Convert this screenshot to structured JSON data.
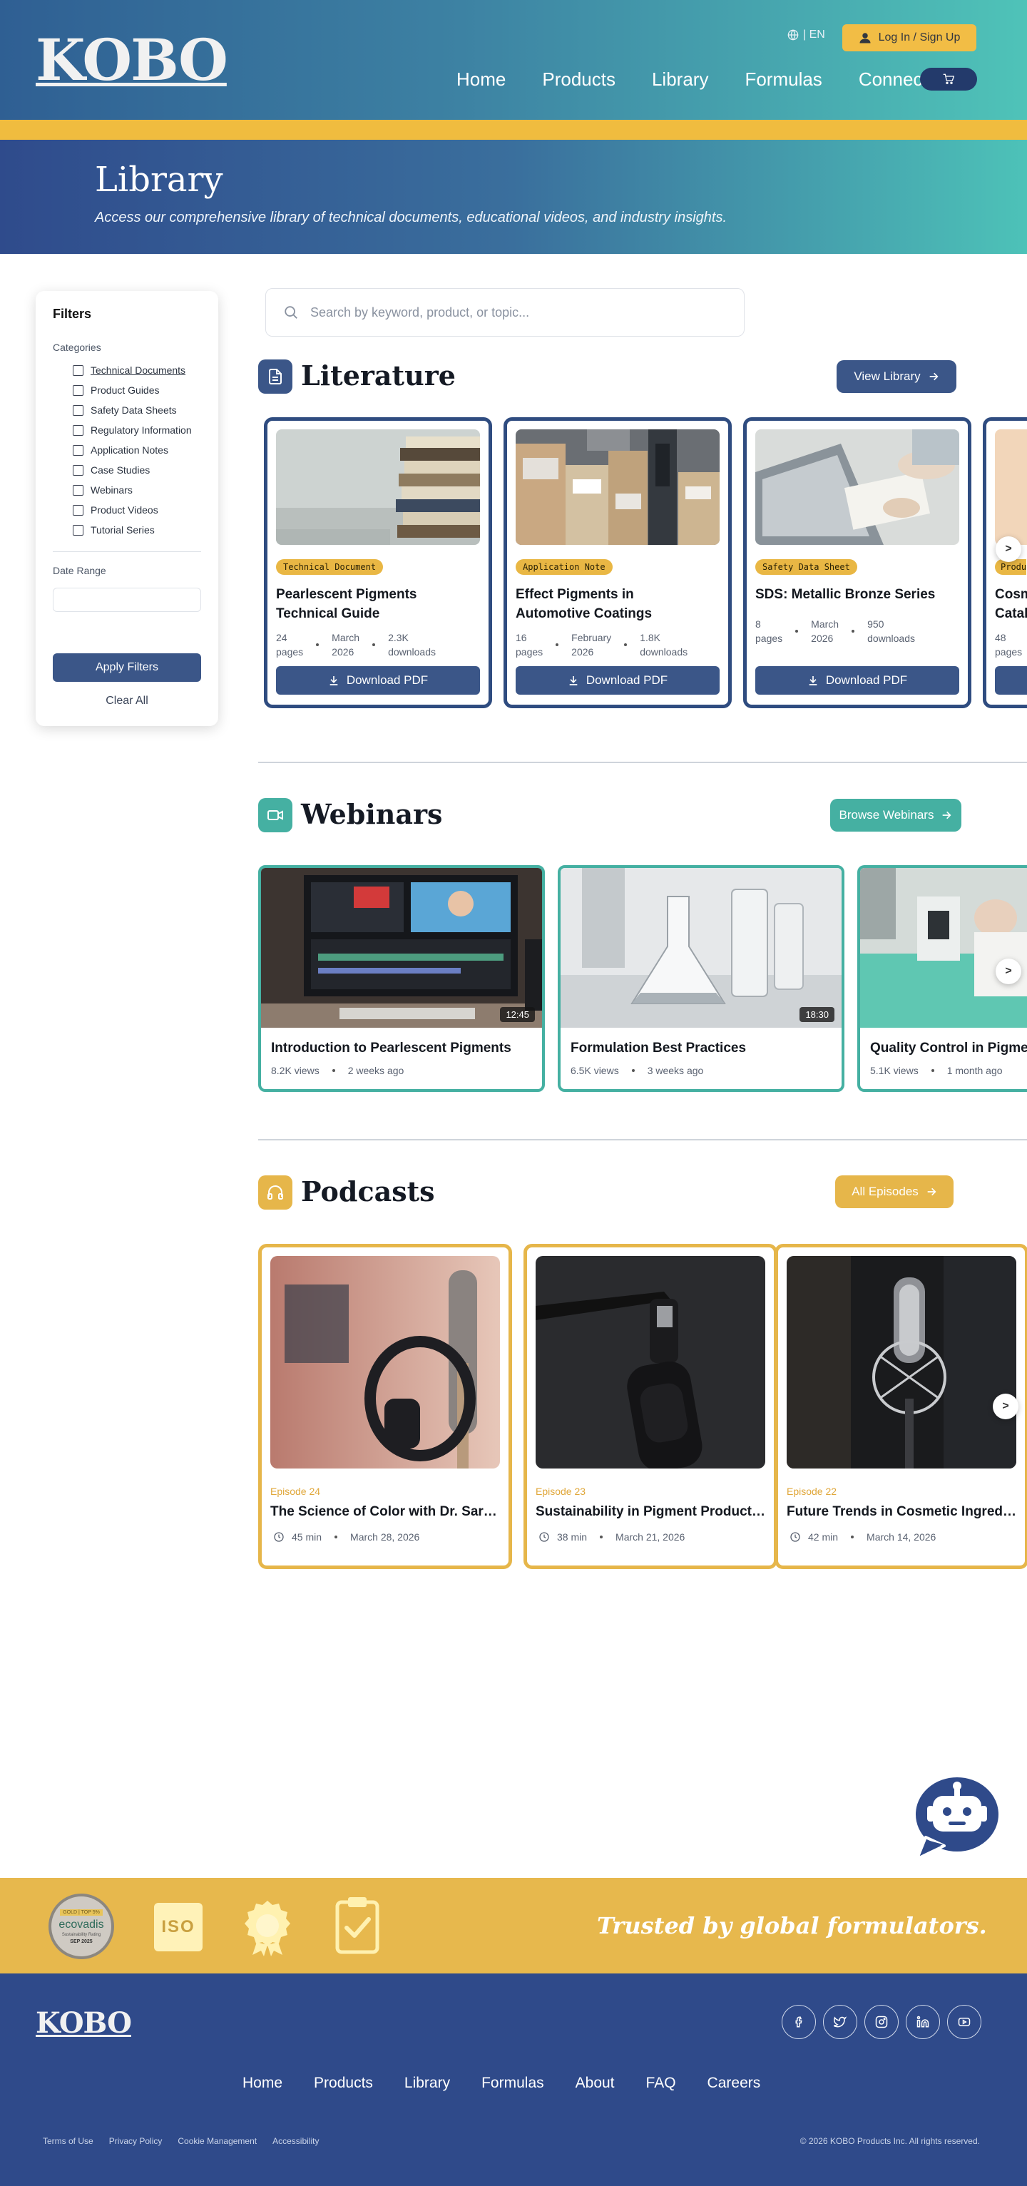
{
  "header": {
    "logo": "KOBO",
    "lang": "| EN",
    "login_label": "Log In / Sign Up",
    "nav": [
      "Home",
      "Products",
      "Library",
      "Formulas",
      "Connect"
    ]
  },
  "hero": {
    "title": "Library",
    "subtitle": "Access our comprehensive library of technical documents, educational videos, and industry insights."
  },
  "filters": {
    "title": "Filters",
    "categories_label": "Categories",
    "categories": [
      "Technical Documents",
      "Product Guides",
      "Safety Data Sheets",
      "Regulatory Information",
      "Application Notes",
      "Case Studies",
      "Webinars",
      "Product Videos",
      "Tutorial Series"
    ],
    "date_label": "Date Range",
    "apply_label": "Apply Filters",
    "clear_label": "Clear All"
  },
  "search": {
    "placeholder": "Search by keyword, product, or topic..."
  },
  "literature": {
    "title": "Literature",
    "button": "View Library",
    "download_label": "Download PDF",
    "cards": [
      {
        "badge": "Technical Document",
        "title_l1": "Pearlescent Pigments",
        "title_l2": "Technical Guide",
        "pages_n": "24",
        "pages_u": "pages",
        "date_m": "March",
        "date_y": "2026",
        "dl_n": "2.3K",
        "dl_u": "downloads"
      },
      {
        "badge": "Application Note",
        "title_l1": "Effect Pigments in",
        "title_l2": "Automotive Coatings",
        "pages_n": "16",
        "pages_u": "pages",
        "date_m": "February",
        "date_y": "2026",
        "dl_n": "1.8K",
        "dl_u": "downloads"
      },
      {
        "badge": "Safety Data Sheet",
        "title_l1": "SDS: Metallic Bronze Series",
        "title_l2": "",
        "pages_n": "8",
        "pages_u": "pages",
        "date_m": "March",
        "date_y": "2026",
        "dl_n": "950",
        "dl_u": "downloads"
      },
      {
        "badge": "Produ",
        "title_l1": "Cosm",
        "title_l2": "Catal",
        "pages_n": "48",
        "pages_u": "pages"
      }
    ]
  },
  "webinars": {
    "title": "Webinars",
    "button": "Browse Webinars",
    "cards": [
      {
        "title": "Introduction to Pearlescent Pigments",
        "views": "8.2K views",
        "ago": "2 weeks ago",
        "duration": "12:45"
      },
      {
        "title": "Formulation Best Practices",
        "views": "6.5K views",
        "ago": "3 weeks ago",
        "duration": "18:30"
      },
      {
        "title": "Quality Control in Pigment",
        "views": "5.1K views",
        "ago": "1 month ago"
      }
    ]
  },
  "podcasts": {
    "title": "Podcasts",
    "button": "All Episodes",
    "cards": [
      {
        "episode": "Episode 24",
        "title": "The Science of Color with Dr. Sarah Che",
        "length": "45 min",
        "date": "March 28, 2026"
      },
      {
        "episode": "Episode 23",
        "title": "Sustainability in Pigment Production",
        "length": "38 min",
        "date": "March 21, 2026"
      },
      {
        "episode": "Episode 22",
        "title": "Future Trends in Cosmetic Ingredie...",
        "length": "42 min",
        "date": "March 14, 2026"
      }
    ]
  },
  "carousel_next": ">",
  "trust": {
    "tagline": "Trusted by global formulators.",
    "ecovadis_top": "GOLD | TOP 5%",
    "ecovadis_name": "ecovadis",
    "ecovadis_sub": "Sustainability Rating",
    "ecovadis_date": "SEP 2025",
    "iso": "ISO"
  },
  "footer": {
    "logo": "KOBO",
    "nav": [
      "Home",
      "Products",
      "Library",
      "Formulas",
      "About",
      "FAQ",
      "Careers"
    ],
    "legal": [
      "Terms of Use",
      "Privacy Policy",
      "Cookie Management",
      "Accessibility"
    ],
    "copyright": "© 2026 KOBO Products Inc. All rights reserved."
  },
  "colors": {
    "primary": "#3b5688",
    "teal": "#45b0a2",
    "gold": "#e6b64a",
    "footer": "#2f4a8a"
  },
  "icons": [
    "globe-icon",
    "user-icon",
    "cart-icon",
    "search-icon",
    "document-icon",
    "video-icon",
    "headphones-icon",
    "download-icon",
    "arrow-right-icon",
    "clock-icon",
    "facebook-icon",
    "twitter-icon",
    "instagram-icon",
    "linkedin-icon",
    "youtube-icon",
    "chat-bot-icon",
    "award-icon",
    "checklist-icon"
  ]
}
